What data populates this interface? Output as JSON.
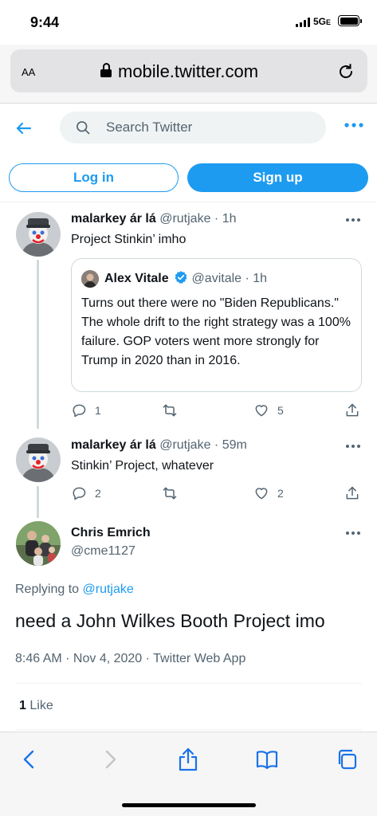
{
  "status_bar": {
    "time": "9:44",
    "network": "5G",
    "network_suffix": "E"
  },
  "browser": {
    "text_size_label": "AA",
    "url": "mobile.twitter.com",
    "toolbar_icons": [
      "back-icon",
      "forward-icon",
      "share-icon",
      "bookmarks-icon",
      "tabs-icon"
    ]
  },
  "twitter": {
    "search_placeholder": "Search Twitter",
    "login_label": "Log in",
    "signup_label": "Sign up",
    "accent_color": "#1d9bf0"
  },
  "tweets": [
    {
      "name": "malarkey ár lá",
      "handle": "@rutjake",
      "time": "1h",
      "text": "Project Stinkin’ imho",
      "quote": {
        "name": "Alex Vitale",
        "verified": true,
        "handle": "@avitale",
        "time": "1h",
        "text": "Turns out there were no \"Biden Republicans.\" The whole drift to the right strategy was a 100% failure. GOP voters went more strongly for Trump in 2020 than in 2016."
      },
      "replies": "1",
      "retweets": "",
      "likes": "5"
    },
    {
      "name": "malarkey ár lá",
      "handle": "@rutjake",
      "time": "59m",
      "text": "Stinkin’ Project, whatever",
      "replies": "2",
      "retweets": "",
      "likes": "2"
    }
  ],
  "focal_tweet": {
    "name": "Chris Emrich",
    "handle": "@cme1127",
    "replying_prefix": "Replying to",
    "replying_to": "@rutjake",
    "text": "need a John Wilkes Booth Project imo",
    "timestamp": "8:46 AM · Nov 4, 2020 · Twitter Web App",
    "like_count": "1",
    "like_label": "Like"
  }
}
